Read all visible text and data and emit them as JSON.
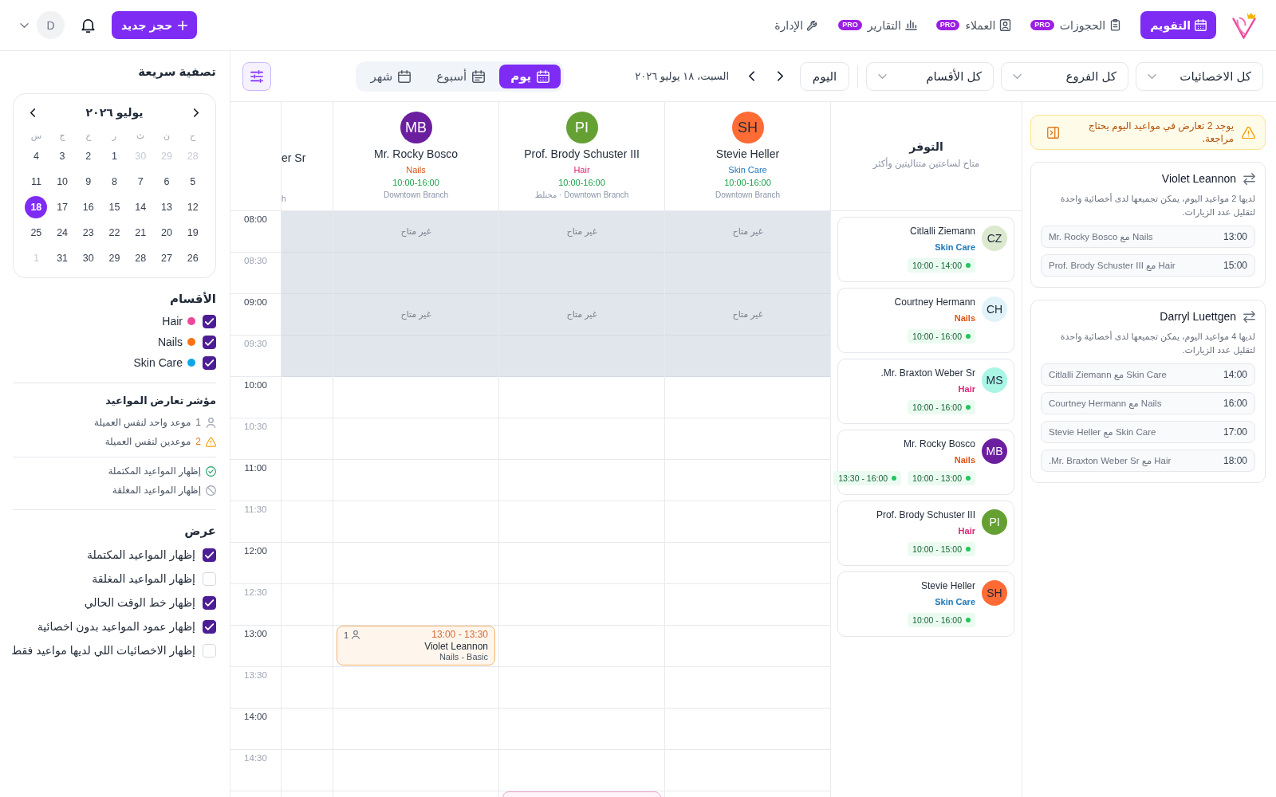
{
  "top_bar": {
    "nav": [
      {
        "label": "التقويم",
        "selected": true
      },
      {
        "label": "الحجوزات",
        "badge": "PRO",
        "selected": false
      },
      {
        "label": "العملاء",
        "badge": "PRO",
        "selected": false
      },
      {
        "label": "التقارير",
        "badge": "PRO",
        "selected": false
      },
      {
        "label": "الإدارة",
        "selected": false
      }
    ],
    "new_booking_button": "حجز جديد",
    "avatar": "D"
  },
  "toolbar": {
    "filters": [
      {
        "value": "كل الاخصائيات"
      },
      {
        "value": "كل الفروع"
      },
      {
        "value": "كل الأقسام"
      }
    ],
    "today_button": "اليوم",
    "date": "السبت، ١٨ يوليو ٢٠٢٦",
    "views": [
      {
        "label": "يوم",
        "selected": true
      },
      {
        "label": "أسبوع",
        "selected": false
      },
      {
        "label": "شهر",
        "selected": false
      }
    ]
  },
  "conflicts": {
    "alert": "يوجد 2 تعارض في مواعيد اليوم يحتاج مراجعة.",
    "clients": [
      {
        "name": "Violet Leannon",
        "note": "لديها 2 مواعيد اليوم، يمكن تجميعها لدى أخصائية واحدة لتقليل عدد الزيارات.",
        "appointments": [
          {
            "label": "Nails مع Mr. Rocky Bosco",
            "time": "13:00"
          },
          {
            "label": "Hair مع Prof. Brody Schuster III",
            "time": "15:00"
          }
        ]
      },
      {
        "name": "Darryl Luettgen",
        "note": "لديها 4 مواعيد اليوم، يمكن تجميعها لدى أخصائية واحدة لتقليل عدد الزيارات.",
        "appointments": [
          {
            "label": "Skin Care مع Citlalli Ziemann",
            "time": "14:00"
          },
          {
            "label": "Nails مع Courtney Hermann",
            "time": "16:00"
          },
          {
            "label": "Skin Care مع Stevie Heller",
            "time": "17:00"
          },
          {
            "label": "Hair مع Mr. Braxton Weber Sr.",
            "time": "18:00"
          }
        ]
      }
    ]
  },
  "availability": {
    "title": "التوفر",
    "subtitle": "متاح لساعتين متتاليتين وأكثر",
    "people": [
      {
        "initials": "CZ",
        "color": "#dbe9cf",
        "name": "Citlalli Ziemann",
        "specialty": {
          "label": "Skin Care",
          "color": "#1f78b8"
        },
        "slots": [
          "10:00 - 14:00"
        ]
      },
      {
        "initials": "CH",
        "color": "#e0f3f9",
        "name": "Courtney Hermann",
        "specialty": {
          "label": "Nails",
          "color": "#dd5416"
        },
        "slots": [
          "10:00 - 16:00"
        ]
      },
      {
        "initials": "MS",
        "color": "#a9f5e6",
        "name": "Mr. Braxton Weber Sr.",
        "specialty": {
          "label": "Hair",
          "color": "#db2777"
        },
        "slots": [
          "10:00 - 16:00"
        ]
      },
      {
        "initials": "MB",
        "color": "#6b1f9f",
        "name": "Mr. Rocky Bosco",
        "specialty": {
          "label": "Nails",
          "color": "#dd5416"
        },
        "slots": [
          "10:00 - 13:00",
          "13:30 - 16:00"
        ]
      },
      {
        "initials": "PI",
        "color": "#65a033",
        "name": "Prof. Brody Schuster III",
        "specialty": {
          "label": "Hair",
          "color": "#db2777"
        },
        "slots": [
          "10:00 - 15:00"
        ]
      },
      {
        "initials": "SH",
        "color": "#ff6b35",
        "name": "Stevie Heller",
        "specialty": {
          "label": "Skin Care",
          "color": "#1f78b8"
        },
        "slots": [
          "10:00 - 16:00"
        ]
      }
    ]
  },
  "schedule": {
    "times": [
      {
        "label": "08:00",
        "kind": "hour"
      },
      {
        "label": "08:30",
        "kind": "half"
      },
      {
        "label": "09:00",
        "kind": "hour"
      },
      {
        "label": "09:30",
        "kind": "half"
      },
      {
        "label": "10:00",
        "kind": "hour"
      },
      {
        "label": "10:30",
        "kind": "half"
      },
      {
        "label": "11:00",
        "kind": "hour"
      },
      {
        "label": "11:30",
        "kind": "half"
      },
      {
        "label": "12:00",
        "kind": "hour"
      },
      {
        "label": "12:30",
        "kind": "half"
      },
      {
        "label": "13:00",
        "kind": "hour"
      },
      {
        "label": "13:30",
        "kind": "half"
      },
      {
        "label": "14:00",
        "kind": "hour"
      },
      {
        "label": "14:30",
        "kind": "half"
      }
    ],
    "columns": [
      {
        "kind": "full",
        "initials": "SH",
        "color": "#ff6b35",
        "name": "Stevie Heller",
        "specialty": {
          "label": "Skin Care",
          "color": "#1f78b8"
        },
        "hours": "10:00-16:00",
        "branch": "Downtown Branch",
        "cells": [
          {
            "unavailable": true,
            "label": "غير متاح"
          },
          {
            "unavailable": true
          },
          {
            "unavailable": true,
            "label": "غير متاح"
          },
          {
            "unavailable": true
          },
          {
            "unavailable": false
          },
          {
            "unavailable": false
          },
          {
            "unavailable": false
          },
          {
            "unavailable": false
          },
          {
            "unavailable": false
          },
          {
            "unavailable": false
          },
          {
            "unavailable": false
          },
          {
            "unavailable": false
          },
          {
            "unavailable": false
          },
          {
            "unavailable": false
          }
        ]
      },
      {
        "kind": "full",
        "initials": "PI",
        "color": "#65a033",
        "name": "Prof. Brody Schuster III",
        "specialty": {
          "label": "Hair",
          "color": "#db2777"
        },
        "hours": "10:00-16:00",
        "branch": "Downtown Branch · مختلط",
        "cells": [
          {
            "unavailable": true,
            "label": "غير متاح"
          },
          {
            "unavailable": true
          },
          {
            "unavailable": true,
            "label": "غير متاح"
          },
          {
            "unavailable": true
          },
          {
            "unavailable": false
          },
          {
            "unavailable": false
          },
          {
            "unavailable": false
          },
          {
            "unavailable": false
          },
          {
            "unavailable": false
          },
          {
            "unavailable": false
          },
          {
            "unavailable": false
          },
          {
            "unavailable": false
          },
          {
            "unavailable": false
          },
          {
            "unavailable": false
          },
          {
            "unavailable": false,
            "appointment": {
              "color": "#f4a3cb"
            }
          }
        ]
      },
      {
        "kind": "full",
        "initials": "MB",
        "color": "#6b1f9f",
        "name": "Mr. Rocky Bosco",
        "specialty": {
          "label": "Nails",
          "color": "#dd5416"
        },
        "hours": "10:00-16:00",
        "branch": "Downtown Branch",
        "cells": [
          {
            "unavailable": true,
            "label": "غير متاح"
          },
          {
            "unavailable": true
          },
          {
            "unavailable": true,
            "label": "غير متاح"
          },
          {
            "unavailable": true
          },
          {
            "unavailable": false
          },
          {
            "unavailable": false
          },
          {
            "unavailable": false
          },
          {
            "unavailable": false
          },
          {
            "unavailable": false
          },
          {
            "unavailable": false
          },
          {
            "unavailable": false,
            "appointment": {
              "time": "13:00 - 13:30",
              "guests": "1",
              "client": "Violet Leannon",
              "service": "Nails - Basic",
              "color": "#f5b26b"
            }
          },
          {
            "unavailable": false
          },
          {
            "unavailable": false
          },
          {
            "unavailable": false
          }
        ]
      },
      {
        "kind": "partial",
        "name": "er Sr",
        "branch": "h",
        "cells": [
          {
            "unavailable": true
          },
          {
            "unavailable": true
          },
          {
            "unavailable": true
          },
          {
            "unavailable": true
          },
          {
            "unavailable": false
          },
          {
            "unavailable": false
          },
          {
            "unavailable": false
          },
          {
            "unavailable": false
          },
          {
            "unavailable": false
          },
          {
            "unavailable": false
          },
          {
            "unavailable": false
          },
          {
            "unavailable": false
          },
          {
            "unavailable": false
          },
          {
            "unavailable": false
          }
        ]
      }
    ]
  },
  "sidebar": {
    "title": "تصفية سريعة",
    "mini_calendar": {
      "month": "يوليو ٢٠٢٦",
      "weekdays": [
        "ح",
        "ن",
        "ث",
        "ر",
        "خ",
        "ج",
        "س"
      ],
      "weeks": [
        [
          {
            "day": "28",
            "muted": true,
            "selected": false
          },
          {
            "day": "29",
            "muted": true,
            "selected": false
          },
          {
            "day": "30",
            "muted": true,
            "selected": false
          },
          {
            "day": "1",
            "muted": false,
            "selected": false
          },
          {
            "day": "2",
            "muted": false,
            "selected": false
          },
          {
            "day": "3",
            "muted": false,
            "selected": false
          },
          {
            "day": "4",
            "muted": false,
            "selected": false
          }
        ],
        [
          {
            "day": "5",
            "muted": false,
            "selected": false
          },
          {
            "day": "6",
            "muted": false,
            "selected": false
          },
          {
            "day": "7",
            "muted": false,
            "selected": false
          },
          {
            "day": "8",
            "muted": false,
            "selected": false
          },
          {
            "day": "9",
            "muted": false,
            "selected": false
          },
          {
            "day": "10",
            "muted": false,
            "selected": false
          },
          {
            "day": "11",
            "muted": false,
            "selected": false
          }
        ],
        [
          {
            "day": "12",
            "muted": false,
            "selected": false
          },
          {
            "day": "13",
            "muted": false,
            "selected": false
          },
          {
            "day": "14",
            "muted": false,
            "selected": false
          },
          {
            "day": "15",
            "muted": false,
            "selected": false
          },
          {
            "day": "16",
            "muted": false,
            "selected": false
          },
          {
            "day": "17",
            "muted": false,
            "selected": false
          },
          {
            "day": "18",
            "muted": false,
            "selected": true
          }
        ],
        [
          {
            "day": "19",
            "muted": false,
            "selected": false
          },
          {
            "day": "20",
            "muted": false,
            "selected": false
          },
          {
            "day": "21",
            "muted": false,
            "selected": false
          },
          {
            "day": "22",
            "muted": false,
            "selected": false
          },
          {
            "day": "23",
            "muted": false,
            "selected": false
          },
          {
            "day": "24",
            "muted": false,
            "selected": false
          },
          {
            "day": "25",
            "muted": false,
            "selected": false
          }
        ],
        [
          {
            "day": "26",
            "muted": false,
            "selected": false
          },
          {
            "day": "27",
            "muted": false,
            "selected": false
          },
          {
            "day": "28",
            "muted": false,
            "selected": false
          },
          {
            "day": "29",
            "muted": false,
            "selected": false
          },
          {
            "day": "30",
            "muted": false,
            "selected": false
          },
          {
            "day": "31",
            "muted": false,
            "selected": false
          },
          {
            "day": "1",
            "muted": true,
            "selected": false
          }
        ]
      ]
    },
    "sections": {
      "title": "الأقسام",
      "items": [
        {
          "label": "Hair",
          "color": "#ec4899",
          "checked": true
        },
        {
          "label": "Nails",
          "color": "#f97316",
          "checked": true
        },
        {
          "label": "Skin Care",
          "color": "#0ea5e9",
          "checked": true
        }
      ]
    },
    "conflict_legend": {
      "title": "مؤشر تعارض المواعيد",
      "items": [
        {
          "kind": "single",
          "count": "1",
          "label": "موعد واحد لنفس العميلة"
        },
        {
          "kind": "double",
          "count": "2",
          "label": "موعدين لنفس العميلة"
        }
      ]
    },
    "status_legend": [
      {
        "kind": "completed",
        "label": "إظهار المواعيد المكتملة"
      },
      {
        "kind": "closed",
        "label": "إظهار المواعيد المغلقة"
      }
    ],
    "display": {
      "title": "عرض",
      "options": [
        {
          "label": "إظهار المواعيد المكتملة",
          "checked": true
        },
        {
          "label": "إظهار المواعيد المغلقة",
          "checked": false
        },
        {
          "label": "إظهار خط الوقت الحالي",
          "checked": true
        },
        {
          "label": "إظهار عمود المواعيد بدون اخصائية",
          "checked": true
        },
        {
          "label": "إظهار الاخصائيات اللي لديها مواعيد فقط",
          "checked": false
        }
      ]
    }
  }
}
